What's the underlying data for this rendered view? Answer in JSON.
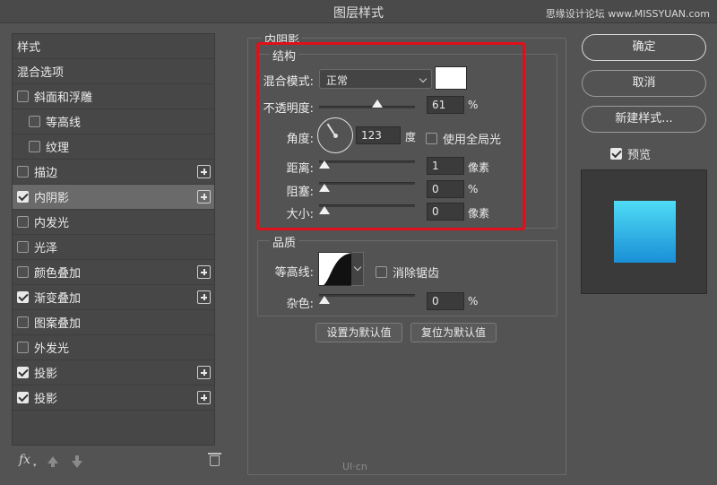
{
  "window": {
    "title": "图层样式",
    "watermark": "思缘设计论坛 www.MISSYUAN.com"
  },
  "style_list": {
    "items": [
      {
        "label": "样式",
        "checkbox": false,
        "checked": false,
        "indent": 0,
        "plus": false,
        "selected": false
      },
      {
        "label": "混合选项",
        "checkbox": false,
        "checked": false,
        "indent": 0,
        "plus": false,
        "selected": false
      },
      {
        "label": "斜面和浮雕",
        "checkbox": true,
        "checked": false,
        "indent": 0,
        "plus": false,
        "selected": false
      },
      {
        "label": "等高线",
        "checkbox": true,
        "checked": false,
        "indent": 1,
        "plus": false,
        "selected": false
      },
      {
        "label": "纹理",
        "checkbox": true,
        "checked": false,
        "indent": 1,
        "plus": false,
        "selected": false
      },
      {
        "label": "描边",
        "checkbox": true,
        "checked": false,
        "indent": 0,
        "plus": true,
        "selected": false
      },
      {
        "label": "内阴影",
        "checkbox": true,
        "checked": true,
        "indent": 0,
        "plus": true,
        "selected": true
      },
      {
        "label": "内发光",
        "checkbox": true,
        "checked": false,
        "indent": 0,
        "plus": false,
        "selected": false
      },
      {
        "label": "光泽",
        "checkbox": true,
        "checked": false,
        "indent": 0,
        "plus": false,
        "selected": false
      },
      {
        "label": "颜色叠加",
        "checkbox": true,
        "checked": false,
        "indent": 0,
        "plus": true,
        "selected": false
      },
      {
        "label": "渐变叠加",
        "checkbox": true,
        "checked": true,
        "indent": 0,
        "plus": true,
        "selected": false
      },
      {
        "label": "图案叠加",
        "checkbox": true,
        "checked": false,
        "indent": 0,
        "plus": false,
        "selected": false
      },
      {
        "label": "外发光",
        "checkbox": true,
        "checked": false,
        "indent": 0,
        "plus": false,
        "selected": false
      },
      {
        "label": "投影",
        "checkbox": true,
        "checked": true,
        "indent": 0,
        "plus": true,
        "selected": false
      },
      {
        "label": "投影",
        "checkbox": true,
        "checked": true,
        "indent": 0,
        "plus": true,
        "selected": false
      }
    ],
    "toolbar": {
      "fx_label": "fx"
    }
  },
  "inner_shadow": {
    "section_title": "内阴影",
    "structure": {
      "title": "结构",
      "blend_mode_label": "混合模式:",
      "blend_mode_value": "正常",
      "shadow_color": "#ffffff",
      "opacity_label": "不透明度:",
      "opacity_value": "61",
      "opacity_unit": "%",
      "opacity_fraction": 0.61,
      "angle_label": "角度:",
      "angle_value": "123",
      "angle_unit": "度",
      "use_global_light_label": "使用全局光",
      "use_global_light_checked": false,
      "distance_label": "距离:",
      "distance_value": "1",
      "distance_unit": "像素",
      "choke_label": "阻塞:",
      "choke_value": "0",
      "choke_unit": "%",
      "size_label": "大小:",
      "size_value": "0",
      "size_unit": "像素"
    },
    "quality": {
      "title": "品质",
      "contour_label": "等高线:",
      "anti_alias_label": "消除锯齿",
      "anti_alias_checked": false,
      "noise_label": "杂色:",
      "noise_value": "0",
      "noise_unit": "%"
    },
    "set_default_label": "设置为默认值",
    "reset_default_label": "复位为默认值"
  },
  "actions": {
    "ok_label": "确定",
    "cancel_label": "取消",
    "new_style_label": "新建样式...",
    "preview_label": "预览",
    "preview_checked": true
  },
  "bottom_watermark": "UI·cn",
  "colors": {
    "highlight_box": "#e0101a",
    "preview_gradient_top": "#4fdcf5",
    "preview_gradient_bottom": "#1a8fd6"
  }
}
